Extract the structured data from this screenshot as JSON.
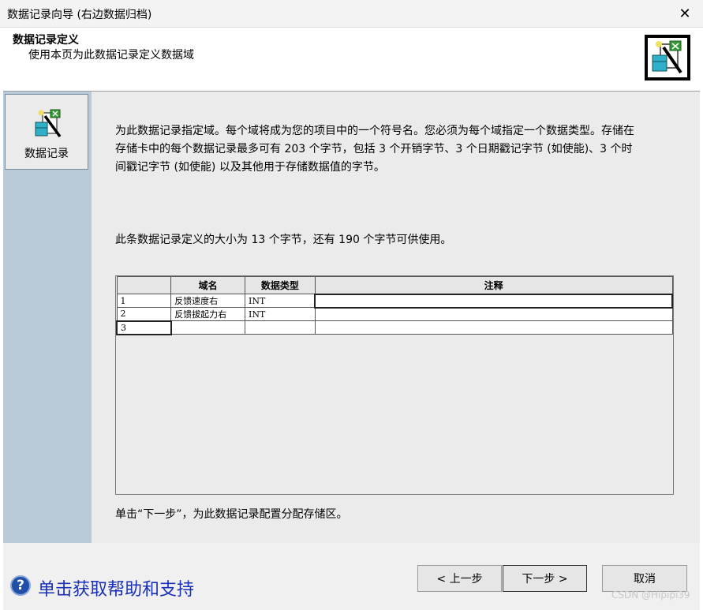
{
  "window": {
    "title": "数据记录向导 (右边数据归档)",
    "close_glyph": "✕"
  },
  "header": {
    "title": "数据记录定义",
    "subtitle": "使用本页为此数据记录定义数据域"
  },
  "sidebar": {
    "items": [
      {
        "label": "数据记录",
        "icon": "data-log-icon"
      }
    ]
  },
  "main": {
    "intro_lines": [
      "为此数据记录指定域。每个域将成为您的项目中的一个符号名。您必须为每个域指定一个数据类型。存储在",
      "存储卡中的每个数据记录最多可有 203 个字节，包括 3 个开销字节、3 个日期戳记字节 (如使能)、3 个时",
      "间戳记字节 (如使能) 以及其他用于存储数据值的字节。"
    ],
    "size_info": "此条数据记录定义的大小为 13 个字节，还有 190 个字节可供使用。",
    "table": {
      "headers": [
        "域名",
        "数据类型",
        "注释"
      ],
      "rows": [
        {
          "num": "1",
          "name": "反馈速度右",
          "type": "INT",
          "comment": ""
        },
        {
          "num": "2",
          "name": "反馈拔起力右",
          "type": "INT",
          "comment": ""
        },
        {
          "num": "3",
          "name": "",
          "type": "",
          "comment": ""
        }
      ]
    },
    "footer_note": "单击“下一步”，为此数据记录配置分配存储区。"
  },
  "footer": {
    "help_icon": "help-question-icon",
    "help_glyph": "?",
    "help_text": "单击获取帮助和支持",
    "back_label": "< 上一步",
    "next_label": "下一步 >",
    "cancel_label": "取消"
  },
  "watermark": "CSDN @Hipipi39"
}
